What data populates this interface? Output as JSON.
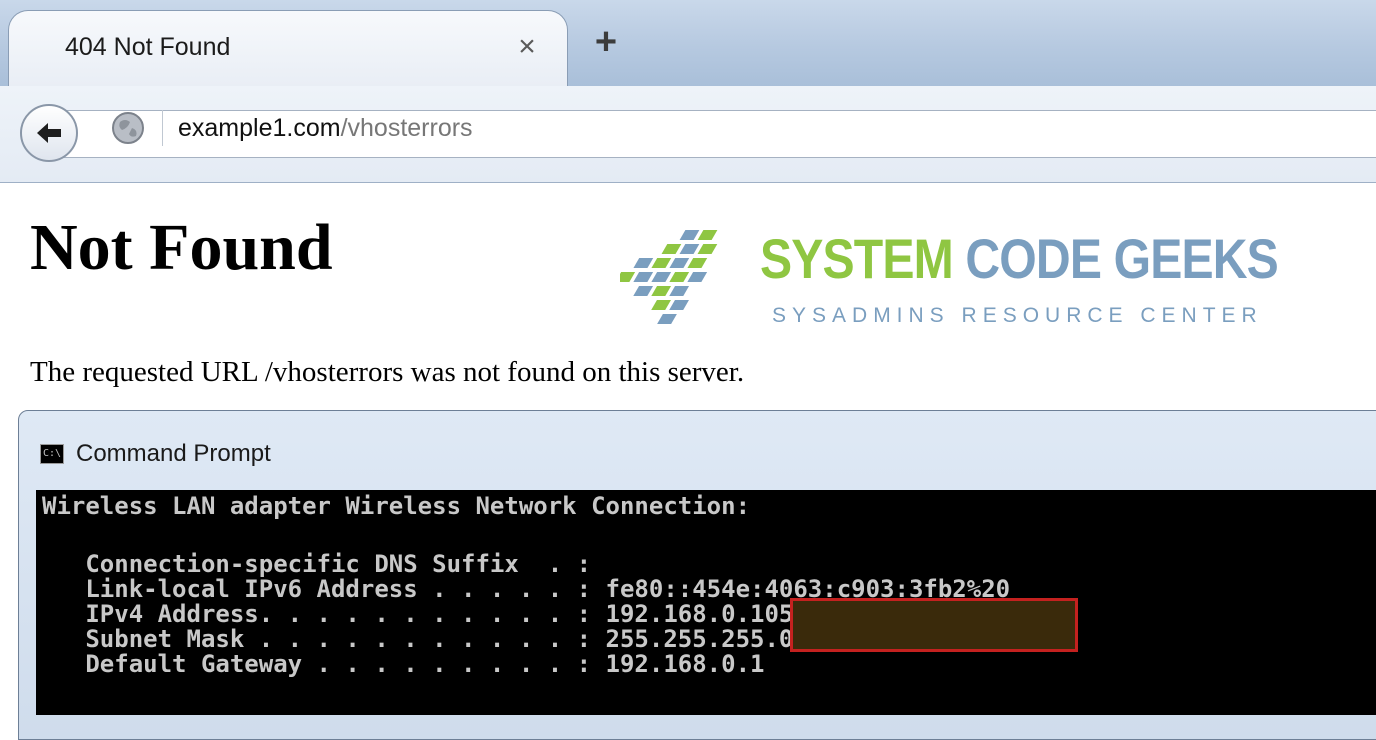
{
  "browser": {
    "tab": {
      "title": "404 Not Found",
      "close_glyph": "×"
    },
    "new_tab_glyph": "+",
    "address": {
      "host": "example1.com",
      "path": "/vhosterrors"
    },
    "icons": {
      "back": "back-arrow-icon",
      "site": "globe-icon"
    }
  },
  "page": {
    "title": "Not Found",
    "message": "The requested URL /vhosterrors was not found on this server.",
    "logo": {
      "word1": "SYSTEM",
      "word2": "CODE GEEKS",
      "tagline": "SYSADMINS RESOURCE CENTER",
      "colors": {
        "green": "#8fc642",
        "blue": "#7a9ebf"
      }
    }
  },
  "cmd": {
    "icon_text": "C:\\",
    "title": "Command Prompt",
    "lines": [
      "Wireless LAN adapter Wireless Network Connection:",
      "",
      "   Connection-specific DNS Suffix  . :",
      "   Link-local IPv6 Address . . . . . : fe80::454e:4063:c903:3fb2%20",
      "   IPv4 Address. . . . . . . . . . . : 192.168.0.105",
      "   Subnet Mask . . . . . . . . . . . : 255.255.255.0",
      "   Default Gateway . . . . . . . . . : 192.168.0.1"
    ],
    "highlight_color": "#c4211f"
  }
}
